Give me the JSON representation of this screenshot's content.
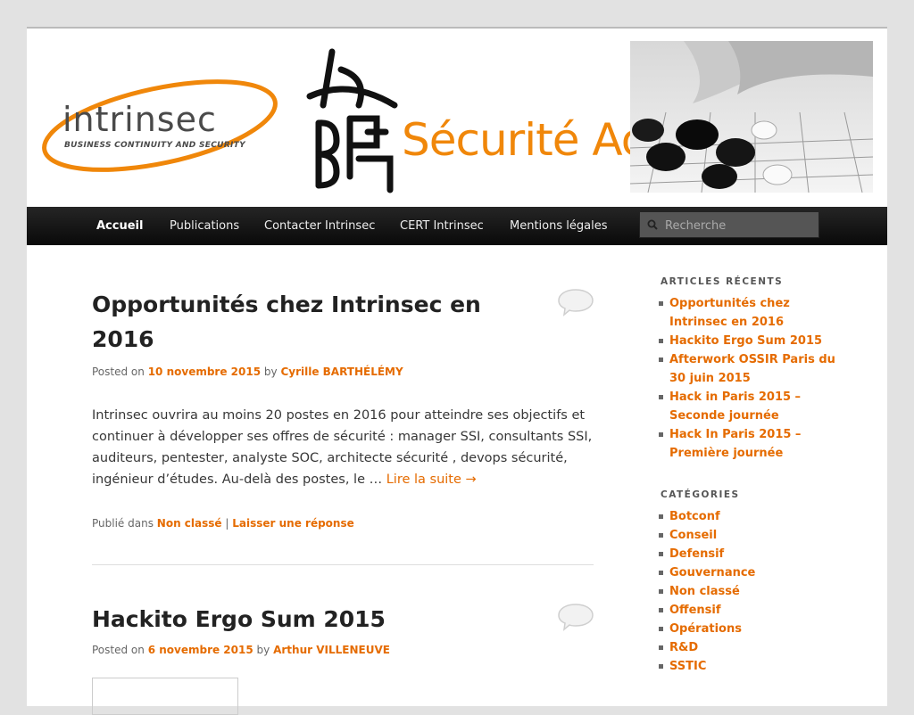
{
  "banner": {
    "logo_word": "intrinsec",
    "logo_tagline": "BUSINESS CONTINUITY AND SECURITY",
    "tagline": "Sécurité Active®"
  },
  "nav": {
    "items": [
      {
        "label": "Accueil",
        "active": true
      },
      {
        "label": "Publications"
      },
      {
        "label": "Contacter Intrinsec"
      },
      {
        "label": "CERT Intrinsec"
      },
      {
        "label": "Mentions légales"
      }
    ],
    "search_placeholder": "Recherche"
  },
  "articles": [
    {
      "title": "Opportunités chez Intrinsec en 2016",
      "posted_on": "Posted on",
      "date": "10 novembre 2015",
      "by": "by",
      "author": "Cyrille BARTHÉLÉMY",
      "excerpt": "Intrinsec ouvrira au moins 20 postes en 2016 pour atteindre ses objectifs et continuer à développer ses offres de sécurité : manager SSI, consultants SSI, auditeurs, pentester, analyste SOC, architecte sécurité , devops sécurité, ingénieur d’études. Au-delà des postes, le … ",
      "read_more": "Lire la suite →",
      "published_in": "Publié dans",
      "category": "Non classé",
      "separator": "|",
      "reply": "Laisser une réponse"
    },
    {
      "title": "Hackito Ergo Sum 2015",
      "posted_on": "Posted on",
      "date": "6 novembre 2015",
      "by": "by",
      "author": "Arthur VILLENEUVE"
    }
  ],
  "sidebar": {
    "recent_title": "ARTICLES RÉCENTS",
    "recent": [
      "Opportunités chez Intrinsec en 2016",
      "Hackito Ergo Sum 2015",
      "Afterwork OSSIR Paris du 30 juin 2015",
      "Hack in Paris 2015 – Seconde journée",
      "Hack In Paris 2015 – Première journée"
    ],
    "categories_title": "CATÉGORIES",
    "categories": [
      "Botconf",
      "Conseil",
      "Defensif",
      "Gouvernance",
      "Non classé",
      "Offensif",
      "Opérations",
      "R&D",
      "SSTIC"
    ]
  },
  "colors": {
    "accent": "#e56b00",
    "nav_bg": "#1a1a1a",
    "page_bg": "#e2e2e2"
  }
}
